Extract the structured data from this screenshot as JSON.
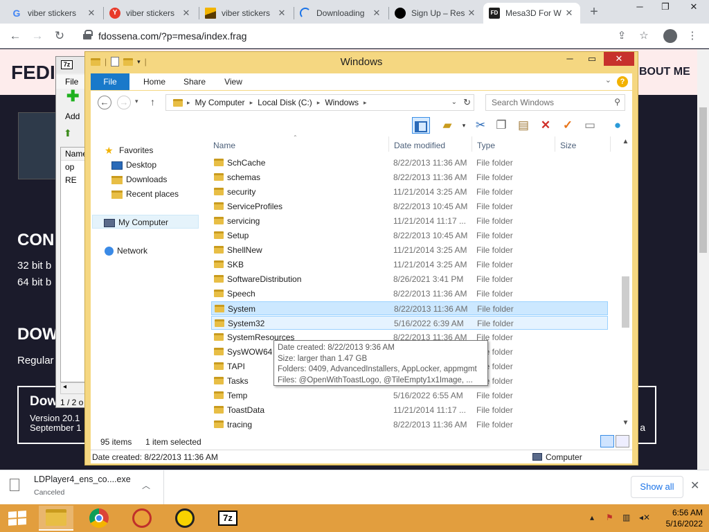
{
  "browser": {
    "tabs": [
      {
        "title": "viber stickers",
        "icon": "google-icon",
        "color": "#4285f4"
      },
      {
        "title": "viber stickers",
        "icon": "yandex-icon",
        "color": "#e83a2a"
      },
      {
        "title": "viber stickers",
        "icon": "image-icon",
        "color": "#f2b400"
      },
      {
        "title": "Downloading",
        "icon": "loading-icon",
        "color": "#1a73e8"
      },
      {
        "title": "Sign Up – Res",
        "icon": "site-icon",
        "color": "#000000"
      },
      {
        "title": "Mesa3D For W",
        "icon": "fd-icon",
        "color": "#202020"
      }
    ],
    "url": "fdossena.com/?p=mesa/index.frag"
  },
  "page": {
    "brand": "FEDI",
    "nav_about": "BOUT ME",
    "sec1": "CON",
    "line1": "32 bit b",
    "line2": "64 bit b",
    "sec2": "DOW",
    "line3": "Regular",
    "download_title": "Dow",
    "download_sub1": "Version 20.1",
    "download_sub2": "September 1",
    "download_right": "a"
  },
  "sevenzip": {
    "logo": "7z",
    "menu_file": "File",
    "add_label": "Add",
    "col_name": "Name",
    "rows": [
      "op",
      "RE"
    ],
    "status": "1 / 2 o"
  },
  "explorer": {
    "title": "Windows",
    "ribbon_tabs": [
      "File",
      "Home",
      "Share",
      "View"
    ],
    "breadcrumb": [
      "My Computer",
      "Local Disk (C:)",
      "Windows"
    ],
    "search_placeholder": "Search Windows",
    "columns": {
      "name": "Name",
      "date": "Date modified",
      "type": "Type",
      "size": "Size"
    },
    "nav": {
      "favorites": "Favorites",
      "desktop": "Desktop",
      "downloads": "Downloads",
      "recent": "Recent places",
      "my_computer": "My Computer",
      "network": "Network"
    },
    "files": [
      {
        "name": "SchCache",
        "date": "8/22/2013 11:36 AM",
        "type": "File folder"
      },
      {
        "name": "schemas",
        "date": "8/22/2013 11:36 AM",
        "type": "File folder"
      },
      {
        "name": "security",
        "date": "11/21/2014 3:25 AM",
        "type": "File folder"
      },
      {
        "name": "ServiceProfiles",
        "date": "8/22/2013 10:45 AM",
        "type": "File folder"
      },
      {
        "name": "servicing",
        "date": "11/21/2014 11:17 ...",
        "type": "File folder"
      },
      {
        "name": "Setup",
        "date": "8/22/2013 10:45 AM",
        "type": "File folder"
      },
      {
        "name": "ShellNew",
        "date": "11/21/2014 3:25 AM",
        "type": "File folder"
      },
      {
        "name": "SKB",
        "date": "11/21/2014 3:25 AM",
        "type": "File folder"
      },
      {
        "name": "SoftwareDistribution",
        "date": "8/26/2021 3:41 PM",
        "type": "File folder"
      },
      {
        "name": "Speech",
        "date": "8/22/2013 11:36 AM",
        "type": "File folder"
      },
      {
        "name": "System",
        "date": "8/22/2013 11:36 AM",
        "type": "File folder",
        "state": "selected"
      },
      {
        "name": "System32",
        "date": "5/16/2022 6:39 AM",
        "type": "File folder",
        "state": "hover"
      },
      {
        "name": "SystemResources",
        "date": "8/22/2013 11:36 AM",
        "type": "File folder"
      },
      {
        "name": "SysWOW64",
        "date": "",
        "type": "File folder"
      },
      {
        "name": "TAPI",
        "date": "",
        "type": "File folder"
      },
      {
        "name": "Tasks",
        "date": "",
        "type": "File folder"
      },
      {
        "name": "Temp",
        "date": "5/16/2022 6:55 AM",
        "type": "File folder"
      },
      {
        "name": "ToastData",
        "date": "11/21/2014 11:17 ...",
        "type": "File folder"
      },
      {
        "name": "tracing",
        "date": "8/22/2013 11:36 AM",
        "type": "File folder"
      }
    ],
    "tooltip": [
      "Date created: 8/22/2013 9:36 AM",
      "Size: larger than 1.47 GB",
      "Folders: 0409, AdvancedInstallers, AppLocker, appmgmt",
      "Files: @OpenWithToastLogo, @TileEmpty1x1Image, ..."
    ],
    "item_count": "95 items",
    "selected_count": "1 item selected",
    "status_left": "Date created: 8/22/2013 11:36 AM",
    "status_right": "Computer"
  },
  "download_shelf": {
    "file": "LDPlayer4_ens_co....exe",
    "status": "Canceled",
    "show_all": "Show all"
  },
  "taskbar": {
    "time": "6:56 AM",
    "date": "5/16/2022",
    "accent": "#e29e3e"
  }
}
